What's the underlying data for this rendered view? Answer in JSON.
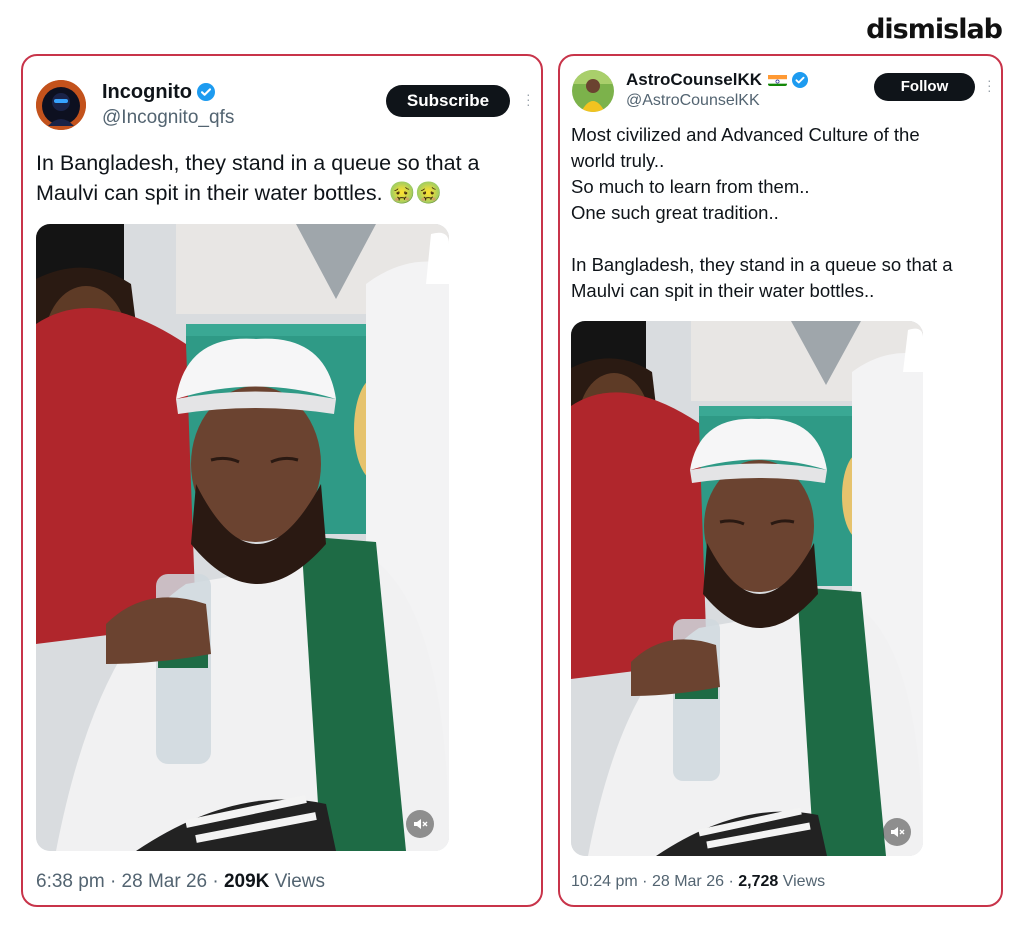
{
  "brand": {
    "logo_text": "dismislab"
  },
  "colors": {
    "frame": "#c8344a",
    "verified": "#1d9bf0",
    "button_bg": "#0f1419"
  },
  "left_post": {
    "display_name": "Incognito",
    "handle": "@Incognito_qfs",
    "verified": true,
    "action_button": "Subscribe",
    "text": "In Bangladesh, they stand in a queue so that a\nMaulvi can spit in their water bottles. 🤢🤢",
    "media_icon": "speaker-muted-icon",
    "time": "6:38 pm",
    "sep": "·",
    "date": "28 Mar 26",
    "views_count": "209K",
    "views_label": "Views"
  },
  "right_post": {
    "display_name": "AstroCounselKK",
    "handle": "@AstroCounselKK",
    "verified": true,
    "flag_icon": "india-flag-icon",
    "action_button": "Follow",
    "text": "Most civilized and Advanced Culture of the\nworld truly..\nSo much to learn from them..\nOne such great tradition..\n\nIn Bangladesh, they stand in a queue so that a\nMaulvi can spit in their water bottles..",
    "media_icon": "speaker-muted-icon",
    "time": "10:24 pm",
    "sep": "·",
    "date": "28 Mar 26",
    "views_count": "2,728",
    "views_label": "Views"
  }
}
